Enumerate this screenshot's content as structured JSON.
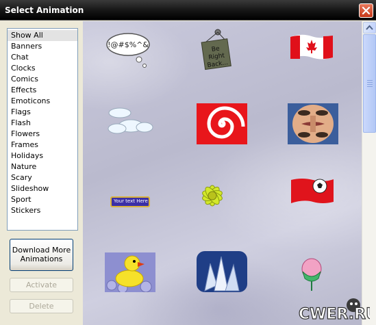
{
  "window": {
    "title": "Select Animation"
  },
  "categories": [
    "Show All",
    "Banners",
    "Chat",
    "Clocks",
    "Comics",
    "Effects",
    "Emoticons",
    "Flags",
    "Flash",
    "Flowers",
    "Frames",
    "Holidays",
    "Nature",
    "Scary",
    "Slideshow",
    "Sport",
    "Stickers"
  ],
  "selected_category": "Show All",
  "buttons": {
    "download": "Download More Animations",
    "activate": "Activate",
    "delete": "Delete"
  },
  "gallery": {
    "thought_text": "!@#$%^&",
    "sign_text": [
      "Be",
      "Right",
      "Back..."
    ],
    "banner_text": "Your text Here"
  },
  "watermark": "CWER.RU",
  "colors": {
    "titlebar": "#000000",
    "close": "#d9553a",
    "gallery_bg": "#c4c4d6",
    "accent": "#316ac5"
  }
}
